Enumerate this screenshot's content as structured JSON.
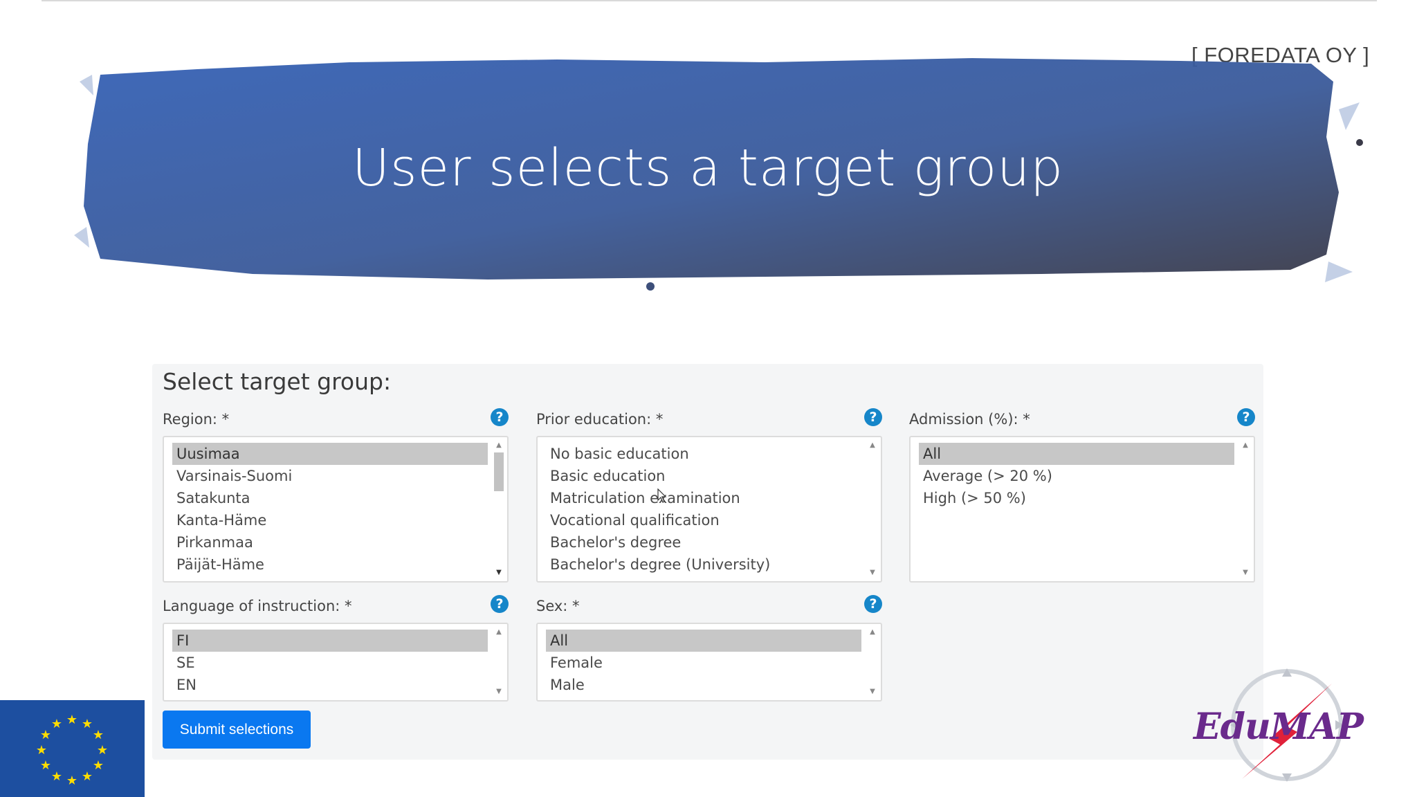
{
  "slide": {
    "company": "[ FOREDATA OY ]",
    "title": "User selects a target group"
  },
  "form": {
    "heading": "Select target group:",
    "region": {
      "label": "Region: *",
      "options": [
        "Uusimaa",
        "Varsinais-Suomi",
        "Satakunta",
        "Kanta-Häme",
        "Pirkanmaa",
        "Päijät-Häme"
      ],
      "selected": "Uusimaa"
    },
    "prior_education": {
      "label": "Prior education: *",
      "options": [
        "No basic education",
        "Basic education",
        "Matriculation examination",
        "Vocational qualification",
        "Bachelor's degree",
        "Bachelor's degree (University)"
      ]
    },
    "admission": {
      "label": "Admission (%): *",
      "options": [
        "All",
        "Average (> 20 %)",
        "High (> 50 %)"
      ],
      "selected": "All"
    },
    "language": {
      "label": "Language of instruction: *",
      "options": [
        "FI",
        "SE",
        "EN"
      ],
      "selected": "FI"
    },
    "sex": {
      "label": "Sex: *",
      "options": [
        "All",
        "Female",
        "Male"
      ],
      "selected": "All"
    },
    "help_icon": "?",
    "submit_label": "Submit selections"
  },
  "logos": {
    "eu_flag_icon": "eu-flag-icon",
    "edumap_text": "EduMAP"
  },
  "colors": {
    "banner_start": "#3561b5",
    "banner_end": "#3a3a48",
    "submit": "#0a78f0",
    "help": "#1686c9",
    "eu_blue": "#1d4fa0",
    "edumap_purple": "#6a2a8c",
    "edumap_red": "#e0213a"
  }
}
